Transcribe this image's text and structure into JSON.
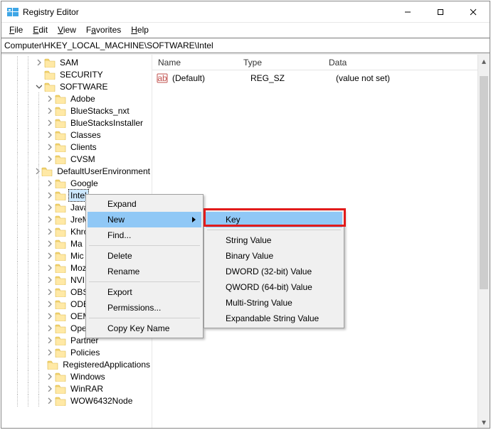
{
  "window": {
    "title": "Registry Editor"
  },
  "menubar": [
    {
      "label": "File",
      "uidx": 0
    },
    {
      "label": "Edit",
      "uidx": 0
    },
    {
      "label": "View",
      "uidx": 0
    },
    {
      "label": "Favorites",
      "uidx": 1
    },
    {
      "label": "Help",
      "uidx": 0
    }
  ],
  "address": "Computer\\HKEY_LOCAL_MACHINE\\SOFTWARE\\Intel",
  "tree": [
    {
      "depth": 3,
      "label": "SAM",
      "expandable": true
    },
    {
      "depth": 3,
      "label": "SECURITY",
      "expandable": false
    },
    {
      "depth": 3,
      "label": "SOFTWARE",
      "expandable": true,
      "expanded": true
    },
    {
      "depth": 4,
      "label": "Adobe",
      "expandable": true
    },
    {
      "depth": 4,
      "label": "BlueStacks_nxt",
      "expandable": true
    },
    {
      "depth": 4,
      "label": "BlueStacksInstaller",
      "expandable": true
    },
    {
      "depth": 4,
      "label": "Classes",
      "expandable": true
    },
    {
      "depth": 4,
      "label": "Clients",
      "expandable": true
    },
    {
      "depth": 4,
      "label": "CVSM",
      "expandable": true
    },
    {
      "depth": 4,
      "label": "DefaultUserEnvironment",
      "expandable": true
    },
    {
      "depth": 4,
      "label": "Google",
      "expandable": true
    },
    {
      "depth": 4,
      "label": "Intel",
      "expandable": true,
      "selected": true
    },
    {
      "depth": 4,
      "label": "JavaSoft",
      "cut": "Java",
      "expandable": true
    },
    {
      "depth": 4,
      "label": "JreMetrics",
      "cut": "JreM",
      "expandable": true
    },
    {
      "depth": 4,
      "label": "Khronos",
      "cut": "Khro",
      "expandable": true
    },
    {
      "depth": 4,
      "label": "Macromedia",
      "cut": "Ma",
      "expandable": true
    },
    {
      "depth": 4,
      "label": "Microsoft",
      "cut": "Mic",
      "expandable": true
    },
    {
      "depth": 4,
      "label": "Mozilla",
      "cut": "Moz",
      "expandable": true
    },
    {
      "depth": 4,
      "label": "NVIDIA",
      "cut": "NVI",
      "expandable": true
    },
    {
      "depth": 4,
      "label": "OBS Studio",
      "cut": "OBS",
      "expandable": true
    },
    {
      "depth": 4,
      "label": "ODBC",
      "cut": "ODE",
      "expandable": true
    },
    {
      "depth": 4,
      "label": "OEM",
      "cut": "OEM",
      "expandable": true
    },
    {
      "depth": 4,
      "label": "OpenSSH",
      "expandable": true
    },
    {
      "depth": 4,
      "label": "Partner",
      "expandable": true
    },
    {
      "depth": 4,
      "label": "Policies",
      "expandable": true
    },
    {
      "depth": 4,
      "label": "RegisteredApplications",
      "expandable": false
    },
    {
      "depth": 4,
      "label": "Windows",
      "expandable": true
    },
    {
      "depth": 4,
      "label": "WinRAR",
      "expandable": true
    },
    {
      "depth": 4,
      "label": "WOW6432Node",
      "expandable": true
    }
  ],
  "columns": {
    "name": "Name",
    "type": "Type",
    "data": "Data"
  },
  "values": [
    {
      "name": "(Default)",
      "type": "REG_SZ",
      "data": "(value not set)"
    }
  ],
  "context_menu_1": {
    "items": [
      {
        "label": "Expand"
      },
      {
        "label": "New",
        "submenu": true,
        "highlight": true
      },
      {
        "label": "Find..."
      },
      {
        "sep": true
      },
      {
        "label": "Delete"
      },
      {
        "label": "Rename"
      },
      {
        "sep": true
      },
      {
        "label": "Export"
      },
      {
        "label": "Permissions..."
      },
      {
        "sep": true
      },
      {
        "label": "Copy Key Name"
      }
    ]
  },
  "context_menu_2": {
    "items": [
      {
        "label": "Key",
        "highlight": true
      },
      {
        "sep": true
      },
      {
        "label": "String Value"
      },
      {
        "label": "Binary Value"
      },
      {
        "label": "DWORD (32-bit) Value"
      },
      {
        "label": "QWORD (64-bit) Value"
      },
      {
        "label": "Multi-String Value"
      },
      {
        "label": "Expandable String Value"
      }
    ]
  }
}
